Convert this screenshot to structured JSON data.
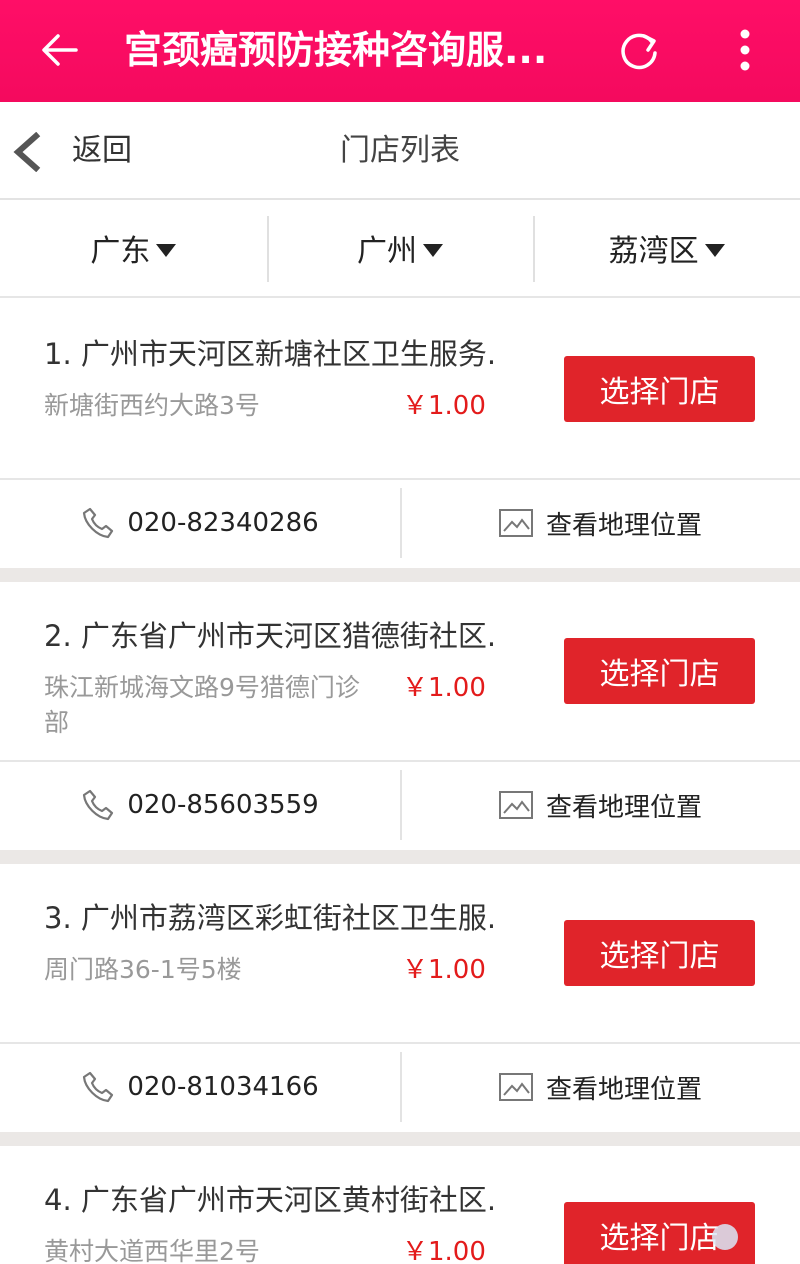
{
  "appbar": {
    "title": "宫颈癌预防接种咨询服...",
    "back_icon": "arrow-left-icon",
    "refresh_icon": "refresh-icon",
    "more_icon": "more-vertical-icon"
  },
  "subbar": {
    "back_label": "返回",
    "page_title": "门店列表"
  },
  "filters": {
    "province": "广东",
    "city": "广州",
    "district": "荔湾区"
  },
  "stores": [
    {
      "name": "1. 广州市天河区新塘社区卫生服务.",
      "address": "新塘街西约大路3号",
      "price": "￥1.00",
      "select_label": "选择门店",
      "phone": "020-82340286",
      "map_label": "查看地理位置"
    },
    {
      "name": "2. 广东省广州市天河区猎德街社区.",
      "address": "珠江新城海文路9号猎德门诊部",
      "price": "￥1.00",
      "select_label": "选择门店",
      "phone": "020-85603559",
      "map_label": "查看地理位置"
    },
    {
      "name": "3. 广州市荔湾区彩虹街社区卫生服.",
      "address": "周门路36-1号5楼",
      "price": "￥1.00",
      "select_label": "选择门店",
      "phone": "020-81034166",
      "map_label": "查看地理位置"
    },
    {
      "name": "4. 广东省广州市天河区黄村街社区.",
      "address": "黄村大道西华里2号",
      "price": "￥1.00",
      "select_label": "选择门店"
    }
  ],
  "colors": {
    "appbar": "#ff0e67",
    "button": "#e0242a",
    "price": "#e31b1b"
  }
}
